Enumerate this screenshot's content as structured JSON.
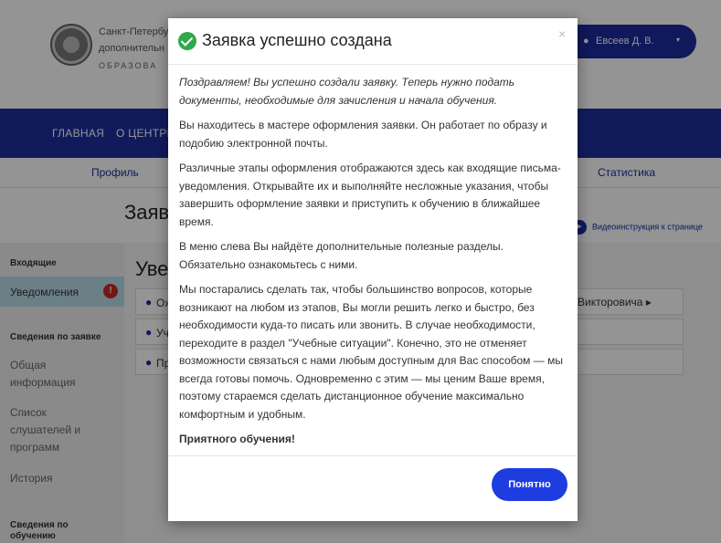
{
  "header": {
    "org_line1": "Санкт-Петербур",
    "org_line2": "дополнительн",
    "org_line3": "ОБРАЗОВА",
    "user_name": "Евсеев Д. В.",
    "user_icon": "user-icon",
    "caret": "▾"
  },
  "main_nav": {
    "home": "ГЛАВНАЯ",
    "about": "О ЦЕНТРЕ"
  },
  "sub_nav": {
    "profile": "Профиль",
    "statistics": "Статистика"
  },
  "page_title": "Заяв",
  "video_link": {
    "label": "Видеоинструкция к странице",
    "icon": "▶"
  },
  "sidebar": {
    "section_incoming": "Входящие",
    "active_item": "Уведомления",
    "alert": "!",
    "section_request": "Сведения по заявке",
    "item_general": "Общая информация",
    "item_list": "Список слушателей и программ",
    "item_history": "История",
    "section_training": "Сведения по обучению"
  },
  "content": {
    "title": "Уве",
    "rows": [
      "Ож",
      "Уч",
      "Пр"
    ],
    "row1_tail": "Викторовича ▸",
    "bullet": "●"
  },
  "modal": {
    "title": "Заявка успешно создана",
    "close": "×",
    "paragraphs": [
      "Поздравляем! Вы успешно создали заявку. Теперь нужно подать документы, необходимые для зачисления и начала обучения.",
      "Вы находитесь в мастере оформления заявки. Он работает по образу и подобию электронной почты.",
      "Различные этапы оформления отображаются здесь как входящие письма-уведомления. Открывайте их и выполняйте несложные указания, чтобы завершить оформление заявки и приступить к обучению в ближайшее время.",
      "В меню слева Вы найдёте дополнительные полезные разделы. Обязательно ознакомьтесь с ними.",
      "Мы постарались сделать так, чтобы большинство вопросов, которые возникают на любом из этапов, Вы могли решить легко и быстро, без необходимости куда-то писать или звонить. В случае необходимости, переходите в раздел \"Учебные ситуации\". Конечно, это не отменяет возможности связаться с нами любым доступным для Вас способом — мы всегда готовы помочь. Одновременно с этим — мы ценим Ваше время, поэтому стараемся сделать дистанционное обучение максимально комфортным и удобным.",
      "Приятного обучения!"
    ],
    "ok_label": "Понятно"
  },
  "colors": {
    "brand": "#1e2f9f",
    "button": "#1d3de0",
    "success": "#2eaa4a",
    "alert": "#c62828"
  }
}
